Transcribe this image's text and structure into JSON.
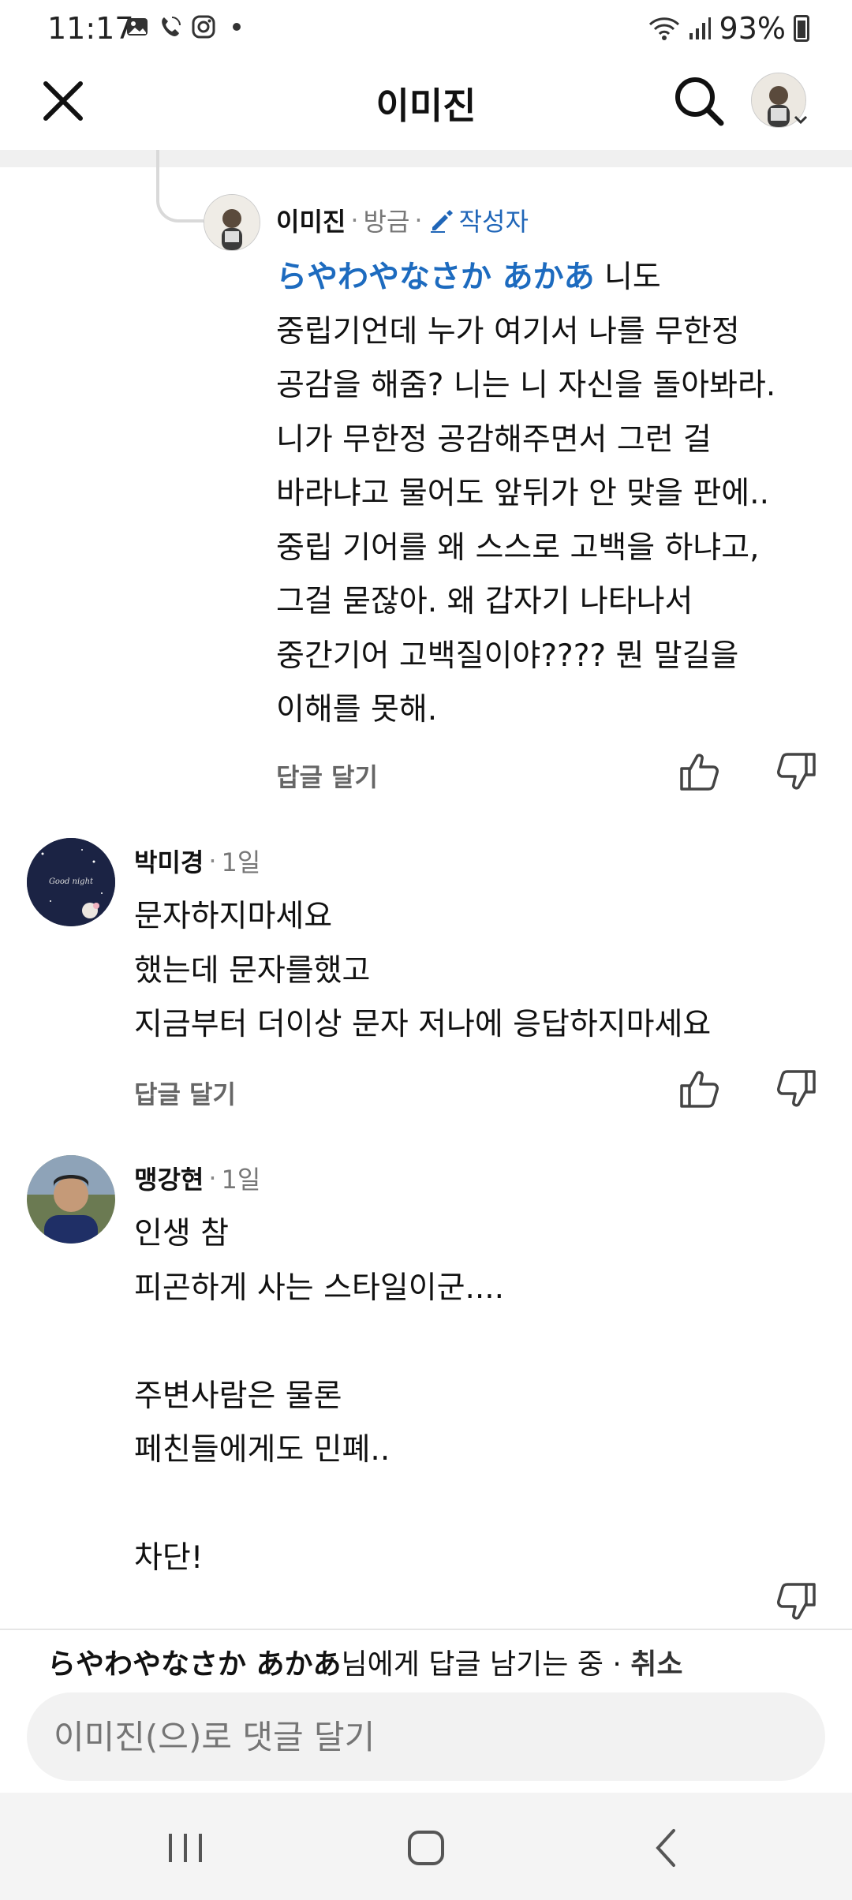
{
  "status_bar": {
    "time": "11:17",
    "battery": "93%",
    "icons_left": [
      "gallery-icon",
      "wifi-call-icon",
      "instagram-icon",
      "dot-icon"
    ],
    "icons_right": [
      "wifi-icon",
      "signal-icon",
      "battery-icon"
    ]
  },
  "header": {
    "title": "이미진",
    "close_icon": "close-icon",
    "search_icon": "search-icon"
  },
  "comments": [
    {
      "author": "이미진",
      "time": "방금",
      "badge": "작성자",
      "mention": "らやわやなさか あかあ",
      "lines": [
        " 니도",
        "중립기언데 누가 여기서 나를 무한정",
        "공감을 해줌? 니는 니 자신을 돌아봐라.",
        "니가 무한정 공감해주면서 그런 걸",
        "바라냐고 물어도 앞뒤가 안 맞을 판에..",
        "중립 기어를 왜 스스로 고백을 하냐고,",
        "그걸 묻잖아. 왜 갑자기 나타나서",
        "중간기어 고백질이야???? 뭔 말길을",
        "이해를 못해."
      ],
      "reply_label": "답글 달기"
    },
    {
      "author": "박미경",
      "time": "1일",
      "avatar_text": "Good night",
      "text": "문자하지마세요\n했는데 문자를했고\n지금부터 더이상 문자 저나에 응답하지마세요",
      "reply_label": "답글 달기"
    },
    {
      "author": "맹강현",
      "time": "1일",
      "text": "인생 참\n피곤하게 사는 스타일이군....\n\n주변사람은 물론\n페친들에게도 민폐..\n\n차단!"
    }
  ],
  "compose": {
    "reply_target_name": "らやわやなさか あかあ",
    "reply_target_suffix": "님에게 답글 남기는 중 · ",
    "cancel_label": "취소",
    "placeholder": "이미진(으)로 댓글 달기"
  },
  "colors": {
    "mention": "#1d6bbf",
    "author_badge": "#2066b8",
    "divider": "#f0f0f0"
  }
}
